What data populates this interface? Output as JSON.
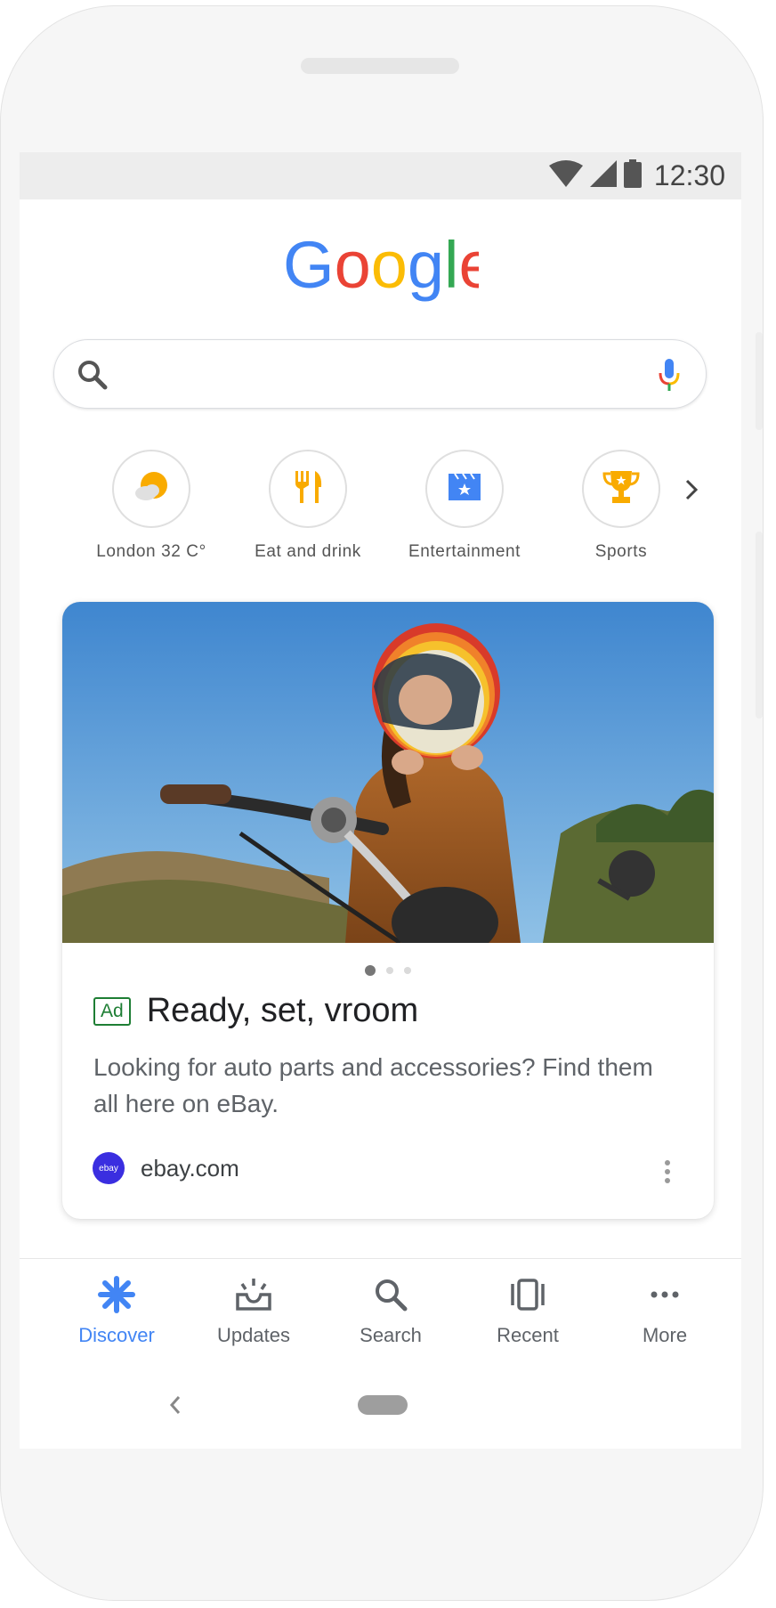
{
  "status_bar": {
    "time": "12:30"
  },
  "logo": {
    "text": "Google"
  },
  "search": {
    "value": "",
    "placeholder": ""
  },
  "shortcuts": [
    {
      "label": "London 32 C°",
      "icon": "weather-sun-cloud-icon"
    },
    {
      "label": "Eat and drink",
      "icon": "fork-knife-icon"
    },
    {
      "label": "Entertainment",
      "icon": "clapperboard-icon"
    },
    {
      "label": "Sports",
      "icon": "trophy-icon"
    }
  ],
  "card": {
    "badge": "Ad",
    "title": "Ready, set, vroom",
    "description": "Looking for auto parts and accessories? Find them all here on eBay.",
    "source": "ebay.com",
    "source_logo_text": "ebay",
    "image": "woman-in-rainbow-motorcycle-helmet-photo",
    "carousel_pages": 3,
    "carousel_active": 1
  },
  "bottom_nav": [
    {
      "label": "Discover",
      "icon": "asterisk-icon",
      "active": true
    },
    {
      "label": "Updates",
      "icon": "inbox-tray-icon",
      "active": false
    },
    {
      "label": "Search",
      "icon": "search-icon",
      "active": false
    },
    {
      "label": "Recent",
      "icon": "cards-stack-icon",
      "active": false
    },
    {
      "label": "More",
      "icon": "more-horizontal-icon",
      "active": false
    }
  ],
  "colors": {
    "accent": "#4285f4",
    "google_blue": "#4285f4",
    "google_red": "#ea4335",
    "google_yellow": "#fbbc05",
    "google_green": "#34a853",
    "ad_green": "#1e7e34",
    "ebay_purple": "#3a2ee0"
  }
}
